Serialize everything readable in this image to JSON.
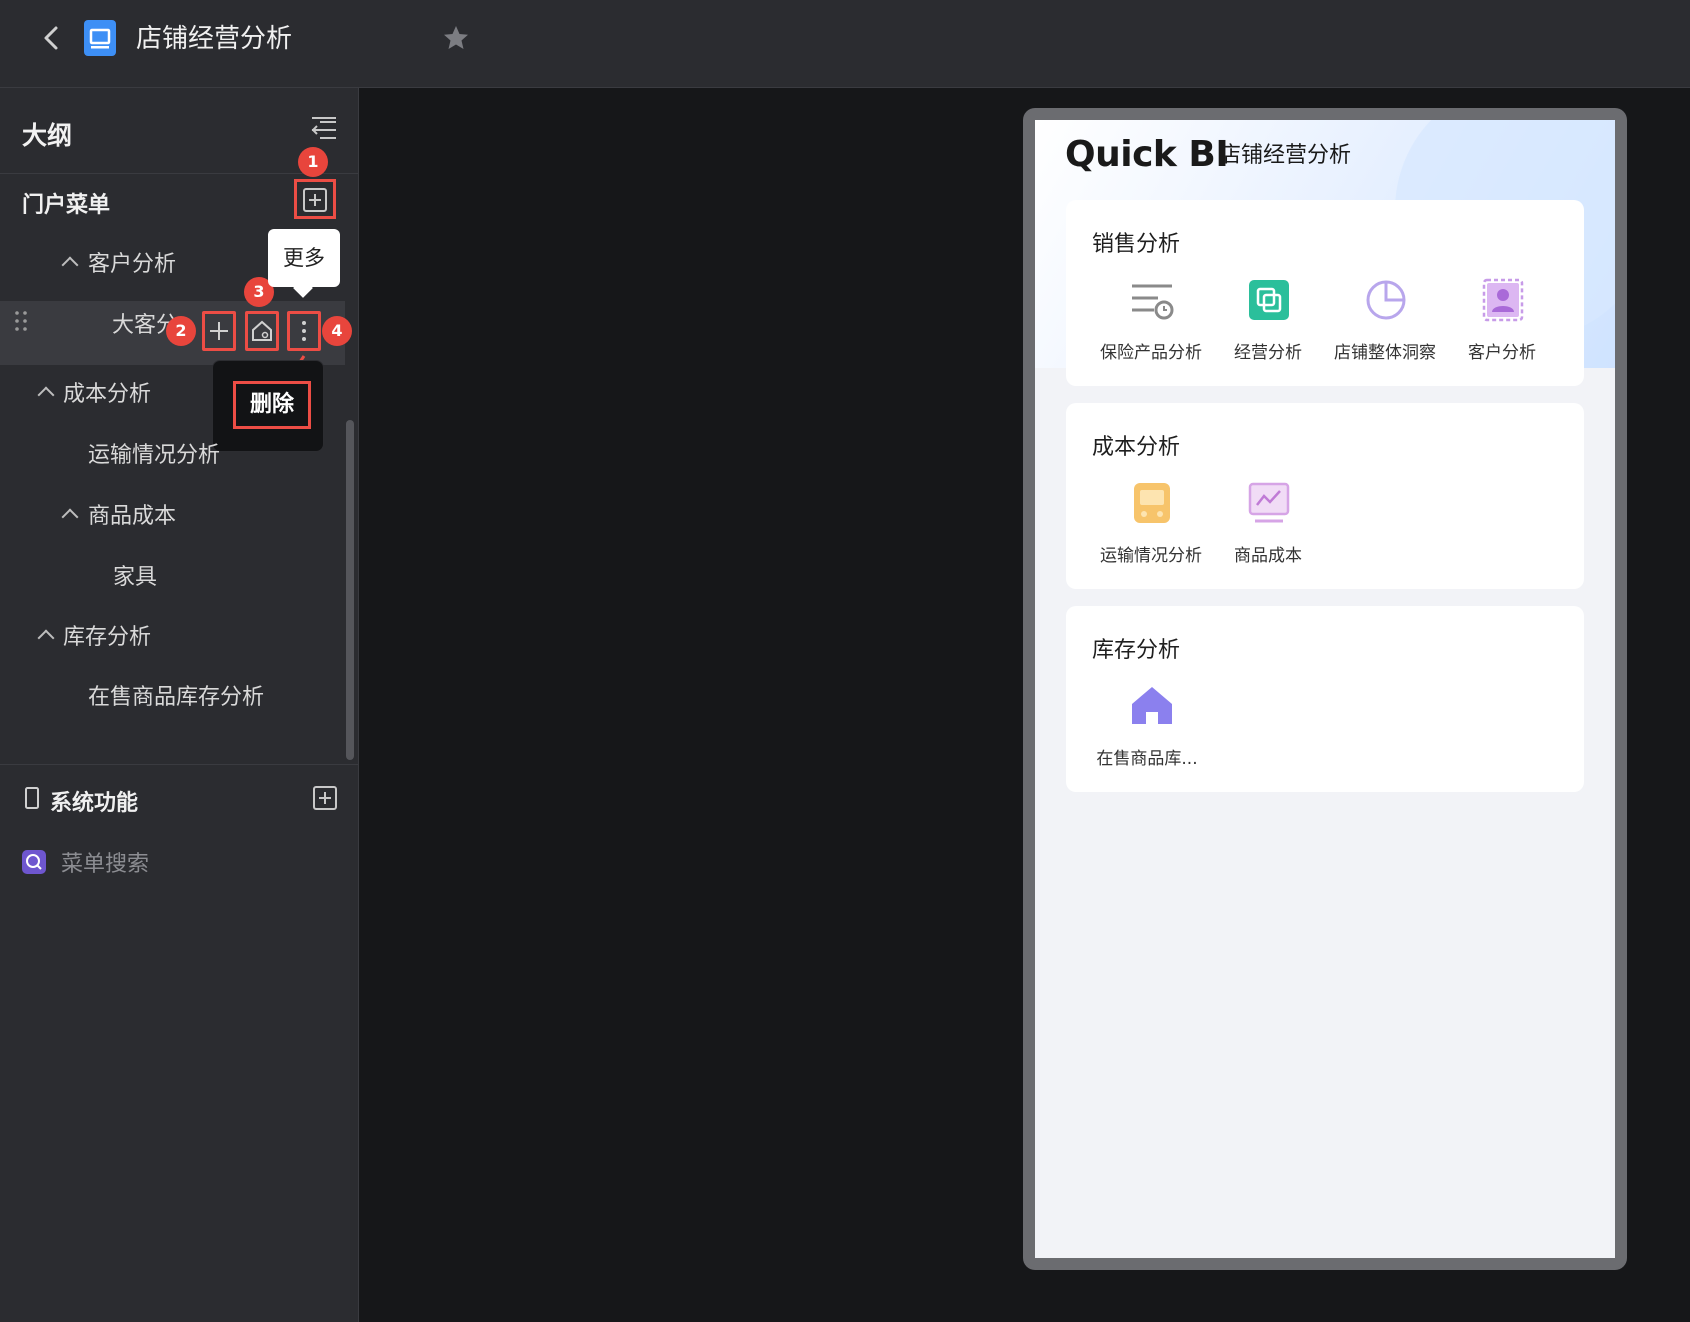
{
  "header": {
    "title": "店铺经营分析"
  },
  "sidebar": {
    "title": "大纲",
    "portal_menu": {
      "title": "门户菜单",
      "items": [
        {
          "label": "客户分析"
        },
        {
          "label": "大客分"
        },
        {
          "label": "成本分析"
        },
        {
          "label": "运输情况分析"
        },
        {
          "label": "商品成本"
        },
        {
          "label": "家具"
        },
        {
          "label": "库存分析"
        },
        {
          "label": "在售商品库存分析"
        }
      ]
    },
    "tooltip_more": "更多",
    "context_menu": {
      "delete": "删除"
    },
    "badges": [
      "1",
      "2",
      "3",
      "4"
    ],
    "system": {
      "title": "系统功能",
      "items": [
        {
          "label": "菜单搜索"
        }
      ]
    }
  },
  "preview": {
    "logo_text": "Quick BI",
    "logo_subtitle": "店铺经营分析",
    "sections": [
      {
        "title": "销售分析",
        "tiles": [
          {
            "label": "保险产品分析",
            "icon": "list-clock-icon",
            "color": "#8a8a8a"
          },
          {
            "label": "经营分析",
            "icon": "copy-square-icon",
            "color": "#2bbf9b"
          },
          {
            "label": "店铺整体洞察",
            "icon": "pie-chart-icon",
            "color": "#b8a6ec"
          },
          {
            "label": "客户分析",
            "icon": "user-card-icon",
            "color": "#c79be8"
          }
        ]
      },
      {
        "title": "成本分析",
        "tiles": [
          {
            "label": "运输情况分析",
            "icon": "train-icon",
            "color": "#f7c46b"
          },
          {
            "label": "商品成本",
            "icon": "line-monitor-icon",
            "color": "#d6a4e6"
          }
        ]
      },
      {
        "title": "库存分析",
        "tiles": [
          {
            "label": "在售商品库...",
            "icon": "house-icon",
            "color": "#8b80ee"
          }
        ]
      }
    ]
  },
  "colors": {
    "annotation_red": "#ec4d45",
    "sidebar_bg": "#2b2c30",
    "canvas_bg": "#161719",
    "app_blue": "#3d8ff5"
  }
}
